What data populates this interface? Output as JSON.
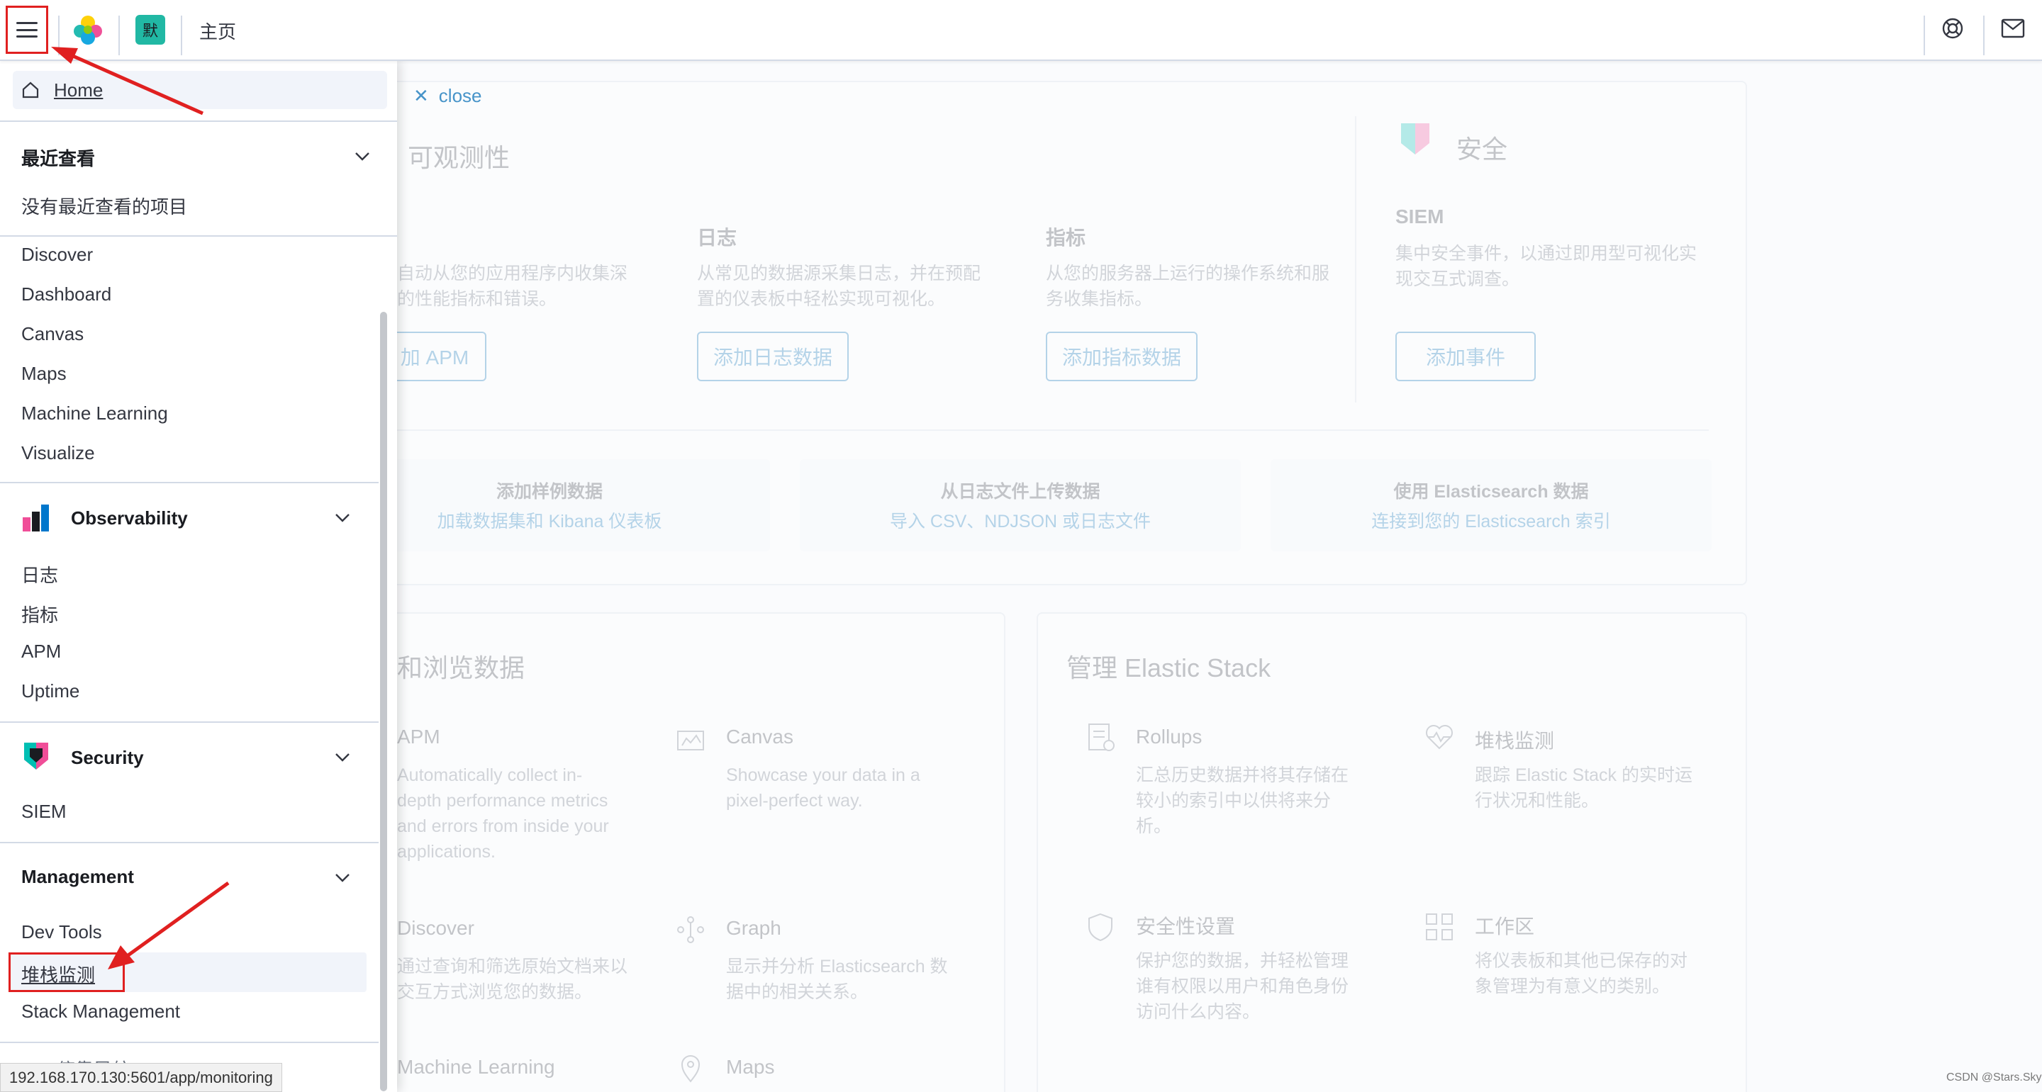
{
  "header": {
    "menu_icon": "hamburger-menu-icon",
    "space_avatar": "默",
    "breadcrumb": "主页",
    "help_icon": "help-lifebuoy-icon",
    "mail_icon": "mail-icon"
  },
  "background": {
    "close_label": "close",
    "observability_title": "可观测性",
    "security_title": "安全",
    "apm_desc": "自动从您的应用程序内收集深\n的性能指标和错误。",
    "apm_btn": "加 APM",
    "logs_title": "日志",
    "logs_desc": "从常见的数据源采集日志，并在预配\n置的仪表板中轻松实现可视化。",
    "logs_btn": "添加日志数据",
    "metrics_title": "指标",
    "metrics_desc": "从您的服务器上运行的操作系统和服\n务收集指标。",
    "metrics_btn": "添加指标数据",
    "siem_title": "SIEM",
    "siem_desc": "集中安全事件，以通过即用型可视化实\n现交互式调查。",
    "siem_btn": "添加事件",
    "sample_boxes": [
      {
        "title": "添加样例数据",
        "desc": "加载数据集和 Kibana 仪表板"
      },
      {
        "title": "从日志文件上传数据",
        "desc": "导入 CSV、NDJSON 或日志文件"
      },
      {
        "title": "使用 Elasticsearch 数据",
        "desc": "连接到您的 Elasticsearch 索引"
      }
    ],
    "explore_title": "和浏览数据",
    "manage_title": "管理 Elastic Stack",
    "tiles": {
      "apm_title": "APM",
      "apm_desc": "Automatically collect in-\ndepth performance metrics\nand errors from inside your\napplications.",
      "canvas_title": "Canvas",
      "canvas_desc": "Showcase your data in a\npixel-perfect way.",
      "rollups_title": "Rollups",
      "rollups_desc": "汇总历史数据并将其存储在\n较小的索引中以供将来分\n析。",
      "monitoring_title": "堆栈监测",
      "monitoring_desc": "跟踪 Elastic Stack 的实时运\n行状况和性能。",
      "discover_title": "Discover",
      "discover_desc": "通过查询和筛选原始文档来以\n交互方式浏览您的数据。",
      "graph_title": "Graph",
      "graph_desc": "显示并分析 Elasticsearch 数\n据中的相关关系。",
      "security_settings_title": "安全性设置",
      "security_settings_desc": "保护您的数据，并轻松管理\n谁有权限以用户和角色身份\n访问什么内容。",
      "workspaces_title": "工作区",
      "workspaces_desc": "将仪表板和其他已保存的对\n象管理为有意义的类别。",
      "ml_title": "Machine Learning",
      "maps_title": "Maps"
    }
  },
  "nav": {
    "home": "Home",
    "recent": {
      "title": "最近查看",
      "empty": "没有最近查看的项目"
    },
    "kibana_links": [
      "Discover",
      "Dashboard",
      "Canvas",
      "Maps",
      "Machine Learning",
      "Visualize"
    ],
    "observability": {
      "title": "Observability",
      "links": [
        "日志",
        "指标",
        "APM",
        "Uptime"
      ]
    },
    "security": {
      "title": "Security",
      "links": [
        "SIEM"
      ]
    },
    "management": {
      "title": "Management",
      "links": [
        "Dev Tools",
        "堆栈监测",
        "Stack Management"
      ]
    },
    "partial_item": "停靠导航"
  },
  "status_url": "192.168.170.130:5601/app/monitoring",
  "watermark": "CSDN @Stars.Sky",
  "colors": {
    "accent": "#006bb4",
    "annotation": "#e02020",
    "avatar": "#21b8a4"
  }
}
